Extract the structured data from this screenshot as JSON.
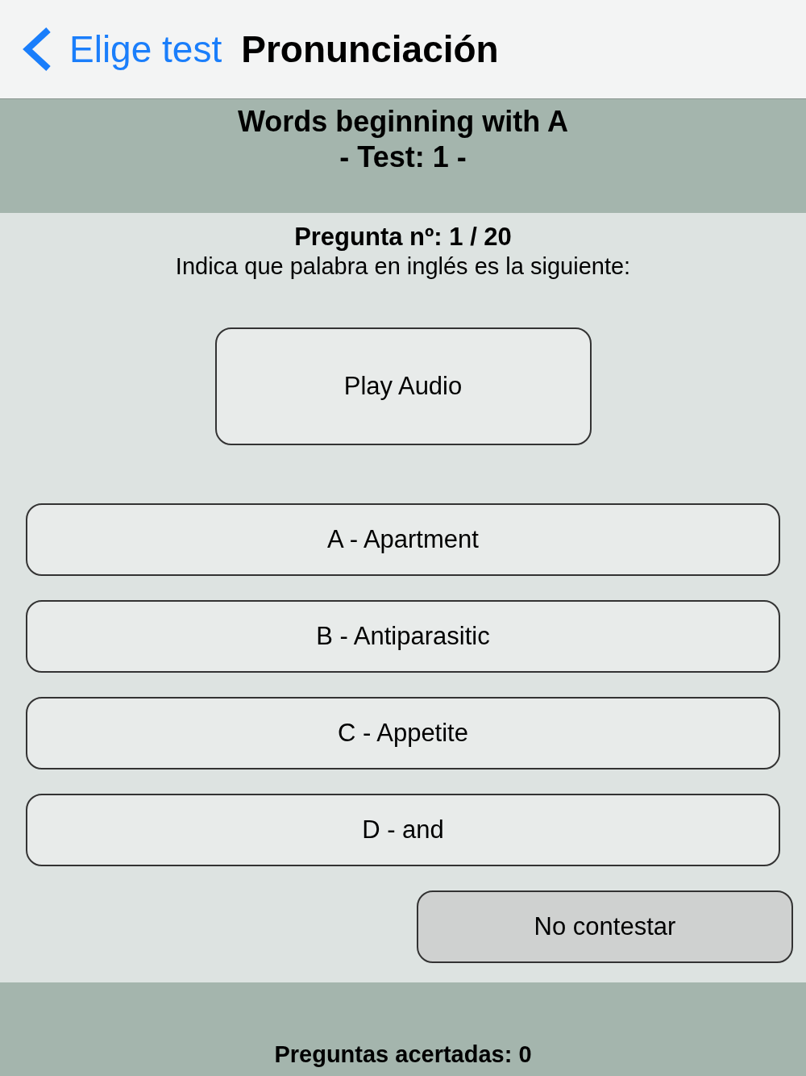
{
  "nav": {
    "back_label": "Elige test",
    "title": "Pronunciación"
  },
  "header": {
    "title": "Words beginning with A",
    "subtitle": "- Test: 1 -"
  },
  "question": {
    "number": "Pregunta nº: 1 / 20",
    "prompt": "Indica que palabra en inglés es la siguiente:"
  },
  "play_button": "Play Audio",
  "answers": [
    {
      "label": "A - Apartment"
    },
    {
      "label": "B - Antiparasitic"
    },
    {
      "label": "C - Appetite"
    },
    {
      "label": "D - and"
    }
  ],
  "skip_button": "No contestar",
  "footer": {
    "correct": "Preguntas acertadas: 0"
  }
}
